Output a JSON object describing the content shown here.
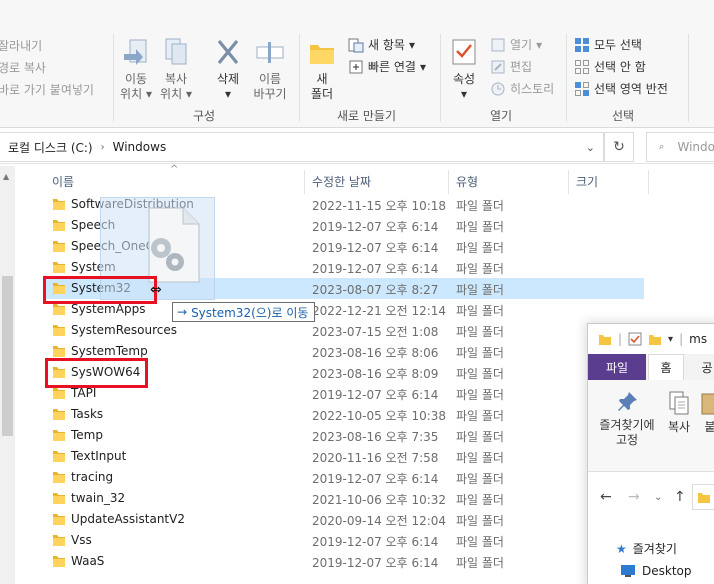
{
  "ribbon": {
    "clipboard_items": [
      "잘라내기",
      "경로 복사",
      "바로 가기 붙여넣기"
    ],
    "move_to": "이동\n위치",
    "move_to_l1": "이동",
    "move_to_l2": "위치",
    "copy_to_l1": "복사",
    "copy_to_l2": "위치",
    "delete_l1": "삭제",
    "rename_l1": "이름",
    "rename_l2": "바꾸기",
    "organize_label": "구성",
    "new_folder_l1": "새",
    "new_folder_l2": "폴더",
    "new_item": "새 항목",
    "easy_access": "빠른 연결",
    "new_label": "새로 만들기",
    "properties": "속성",
    "open": "열기",
    "edit": "편집",
    "history": "히스토리",
    "open_label": "열기",
    "select_all": "모두 선택",
    "select_none": "선택 안 함",
    "invert_selection": "선택 영역 반전",
    "select_label": "선택"
  },
  "address": {
    "crumb_drive": "로컬 디스크 (C:)",
    "crumb_folder": "Windows",
    "search_placeholder": "Windo"
  },
  "columns": {
    "name": "이름",
    "date": "수정한 날짜",
    "type": "유형",
    "size": "크기"
  },
  "files": [
    {
      "name": "SoftwareDistribution",
      "date": "2022-11-15 오후 10:18",
      "type": "파일 폴더"
    },
    {
      "name": "Speech",
      "date": "2019-12-07 오후 6:14",
      "type": "파일 폴더"
    },
    {
      "name": "Speech_OneCore",
      "date": "2019-12-07 오후 6:14",
      "type": "파일 폴더"
    },
    {
      "name": "System",
      "date": "2019-12-07 오후 6:14",
      "type": "파일 폴더"
    },
    {
      "name": "System32",
      "date": "2023-08-07 오후 8:27",
      "type": "파일 폴더"
    },
    {
      "name": "SystemApps",
      "date": "2022-12-21 오전 12:14",
      "type": "파일 폴더"
    },
    {
      "name": "SystemResources",
      "date": "2023-07-15 오전 1:08",
      "type": "파일 폴더"
    },
    {
      "name": "SystemTemp",
      "date": "2023-08-16 오후 8:06",
      "type": "파일 폴더"
    },
    {
      "name": "SysWOW64",
      "date": "2023-08-16 오후 8:09",
      "type": "파일 폴더"
    },
    {
      "name": "TAPI",
      "date": "2019-12-07 오후 6:14",
      "type": "파일 폴더"
    },
    {
      "name": "Tasks",
      "date": "2022-10-05 오후 10:38",
      "type": "파일 폴더"
    },
    {
      "name": "Temp",
      "date": "2023-08-16 오후 7:35",
      "type": "파일 폴더"
    },
    {
      "name": "TextInput",
      "date": "2020-11-16 오전 7:58",
      "type": "파일 폴더"
    },
    {
      "name": "tracing",
      "date": "2019-12-07 오후 6:14",
      "type": "파일 폴더"
    },
    {
      "name": "twain_32",
      "date": "2021-10-06 오후 10:32",
      "type": "파일 폴더"
    },
    {
      "name": "UpdateAssistantV2",
      "date": "2020-09-14 오전 12:04",
      "type": "파일 폴더"
    },
    {
      "name": "Vss",
      "date": "2019-12-07 오후 6:14",
      "type": "파일 폴더"
    },
    {
      "name": "WaaS",
      "date": "2019-12-07 오후 6:14",
      "type": "파일 폴더"
    }
  ],
  "drag_tooltip": "System32(으)로 이동",
  "second_window": {
    "title": "ms",
    "tab_file": "파일",
    "tab_home": "홈",
    "tab_share": "공",
    "pin_l1": "즐겨찾기에",
    "pin_l2": "고정",
    "copy": "복사",
    "paste_partial": "붙",
    "quick_access": "즐겨찾기",
    "desktop": "Desktop"
  },
  "colors": {
    "selection": "#cce8ff",
    "highlight_box": "#e81123",
    "file_tab": "#5a3d8e",
    "folder": "#f5c542"
  }
}
